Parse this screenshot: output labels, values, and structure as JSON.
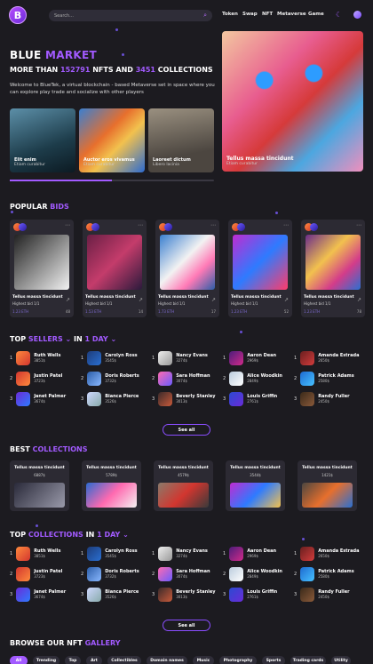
{
  "header": {
    "logo": "B",
    "search_placeholder": "Search...",
    "nav": [
      "Token",
      "Swap",
      "NFT",
      "Metaverse",
      "Game"
    ]
  },
  "hero": {
    "title_a": "BLUE",
    "title_b": "MARKET",
    "subtitle_a": "MORE THAN",
    "nfts": "152791",
    "subtitle_b": "NFTS AND",
    "collections": "3451",
    "subtitle_c": "COLLECTIONS",
    "description": "Welcome to BlueTek, a virtual blockchain - based Metaverse set in space where you can explore play trade and socialize with other players",
    "cards": [
      {
        "title": "Elit enim",
        "sub": "Etiam curabitur"
      },
      {
        "title": "Auctor eros vivamus",
        "sub": "Etiam curabitur"
      },
      {
        "title": "Laoreet dictum",
        "sub": "Libero lacinia"
      }
    ],
    "main_card": {
      "title": "Tellus massa tincidunt",
      "sub": "Etiam curabitur"
    }
  },
  "bids": {
    "title_a": "POPULAR",
    "title_b": "BIDS",
    "items": [
      {
        "title": "Tellus massa tincidunt",
        "hb": "Highest bid 1/1",
        "eth": "1.23 ETH",
        "likes": "48"
      },
      {
        "title": "Tellus massa tincidunt",
        "hb": "Highest bid 1/1",
        "eth": "1.53 ETH",
        "likes": "14"
      },
      {
        "title": "Tellus massa tincidunt",
        "hb": "Highest bid 1/1",
        "eth": "1.73 ETH",
        "likes": "17"
      },
      {
        "title": "Tellus massa tincidunt",
        "hb": "Highest bid 1/1",
        "eth": "1.23 ETH",
        "likes": "52"
      },
      {
        "title": "Tellus massa tincidunt",
        "hb": "Highest bid 1/1",
        "eth": "1.23 ETH",
        "likes": "78"
      }
    ]
  },
  "sellers": {
    "title_a": "TOP",
    "title_b": "SELLERS",
    "title_c": "IN",
    "title_d": "1 DAY",
    "button": "See all",
    "people": [
      [
        "Ruth Wells",
        "3851$"
      ],
      [
        "Carolyn Ross",
        "3545$"
      ],
      [
        "Nancy Evans",
        "3274$"
      ],
      [
        "Aaron Dean",
        "2969$"
      ],
      [
        "Amanda Estrada",
        "2650$"
      ],
      [
        "Justin Patel",
        "3723$"
      ],
      [
        "Doris Roberts",
        "3732$"
      ],
      [
        "Sara Hoffman",
        "3074$"
      ],
      [
        "Alice Woodkin",
        "2849$"
      ],
      [
        "Patrick Adams",
        "2580$"
      ],
      [
        "Janet Palmer",
        "3674$"
      ],
      [
        "Bianca Pierce",
        "3526$"
      ],
      [
        "Beverly Stanley",
        "3013$"
      ],
      [
        "Louis Griffin",
        "2761$"
      ],
      [
        "Randy Fuller",
        "2450$"
      ]
    ]
  },
  "best": {
    "title_a": "BEST",
    "title_b": "COLLECTIONS",
    "items": [
      {
        "title": "Tellus massa tincidunt",
        "val": "6887$"
      },
      {
        "title": "Tellus massa tincidunt",
        "val": "5789$"
      },
      {
        "title": "Tellus massa tincidunt",
        "val": "4579$"
      },
      {
        "title": "Tellus massa tincidunt",
        "val": "3544$"
      },
      {
        "title": "Tellus massa tincidunt",
        "val": "1421$"
      }
    ]
  },
  "topcoll": {
    "title_a": "TOP",
    "title_b": "COLLECTIONS",
    "title_c": "IN",
    "title_d": "1 DAY",
    "button": "See all",
    "people": [
      [
        "Ruth Wells",
        "3851$"
      ],
      [
        "Carolyn Ross",
        "3545$"
      ],
      [
        "Nancy Evans",
        "3274$"
      ],
      [
        "Aaron Dean",
        "2969$"
      ],
      [
        "Amanda Estrada",
        "2650$"
      ],
      [
        "Justin Patel",
        "3723$"
      ],
      [
        "Doris Roberts",
        "3732$"
      ],
      [
        "Sara Hoffman",
        "3074$"
      ],
      [
        "Alice Woodkin",
        "2849$"
      ],
      [
        "Patrick Adams",
        "2580$"
      ],
      [
        "Janet Palmer",
        "3674$"
      ],
      [
        "Bianca Pierce",
        "3526$"
      ],
      [
        "Beverly Stanley",
        "3013$"
      ],
      [
        "Louis Griffin",
        "2761$"
      ],
      [
        "Randy Fuller",
        "2450$"
      ]
    ]
  },
  "gallery": {
    "title_a": "BROWSE OUR NFT",
    "title_b": "GALLERY",
    "tabs": [
      "All",
      "Trending",
      "Top",
      "Art",
      "Collectibles",
      "Domain names",
      "Music",
      "Photography",
      "Sports",
      "Trading cards",
      "Utility"
    ]
  },
  "colors": {
    "accent": "#a25aff",
    "bg": "#1c1b20",
    "card": "#2c2a33"
  }
}
